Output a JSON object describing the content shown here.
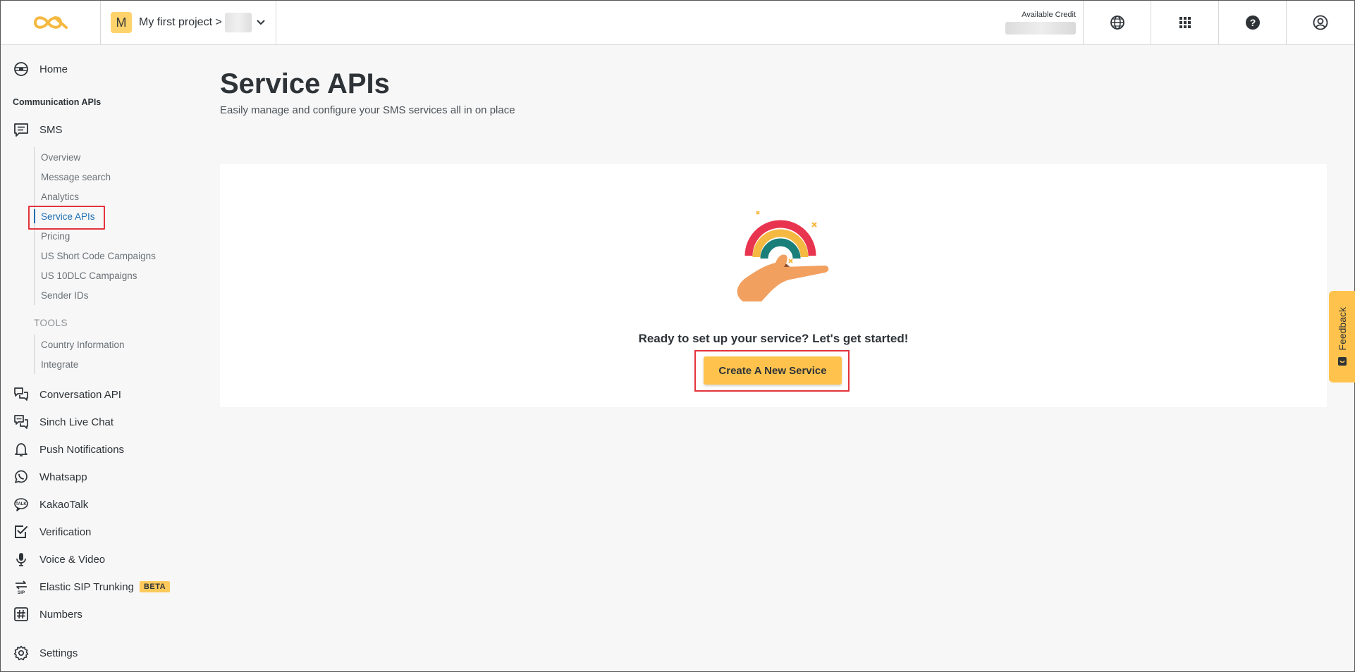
{
  "header": {
    "project_avatar": "M",
    "project_name": "My first project >",
    "available_credit_label": "Available Credit",
    "icons": [
      "logo-icon",
      "globe-icon",
      "apps-grid-icon",
      "help-icon",
      "account-icon"
    ]
  },
  "sidebar": {
    "home": "Home",
    "communication_heading": "Communication APIs",
    "sms": "SMS",
    "sms_items": [
      {
        "label": "Overview"
      },
      {
        "label": "Message search"
      },
      {
        "label": "Analytics"
      },
      {
        "label": "Service APIs"
      },
      {
        "label": "Pricing"
      },
      {
        "label": "US Short Code Campaigns"
      },
      {
        "label": "US 10DLC Campaigns"
      },
      {
        "label": "Sender IDs"
      }
    ],
    "active_item": "Service APIs",
    "tools_heading": "TOOLS",
    "tools_items": [
      {
        "label": "Country Information"
      },
      {
        "label": "Integrate"
      }
    ],
    "items": [
      {
        "label": "Conversation API",
        "icon": "conversation-icon"
      },
      {
        "label": "Sinch Live Chat",
        "icon": "live-chat-icon"
      },
      {
        "label": "Push Notifications",
        "icon": "bell-icon"
      },
      {
        "label": "Whatsapp",
        "icon": "whatsapp-icon"
      },
      {
        "label": "KakaoTalk",
        "icon": "kakaotalk-icon"
      },
      {
        "label": "Verification",
        "icon": "verification-icon"
      },
      {
        "label": "Voice & Video",
        "icon": "microphone-icon"
      },
      {
        "label": "Elastic SIP Trunking",
        "icon": "sip-icon",
        "badge": "BETA"
      },
      {
        "label": "Numbers",
        "icon": "hash-icon"
      }
    ],
    "settings": "Settings"
  },
  "main": {
    "title": "Service APIs",
    "subtitle": "Easily manage and configure your SMS services all in on place",
    "prompt": "Ready to set up your service? Let's get started!",
    "create_button": "Create A New Service"
  },
  "feedback": {
    "label": "Feedback"
  },
  "colors": {
    "accent": "#ffc34d",
    "link_active": "#1f6fb2",
    "highlight": "#e3343c",
    "logo": "#f5b942"
  }
}
